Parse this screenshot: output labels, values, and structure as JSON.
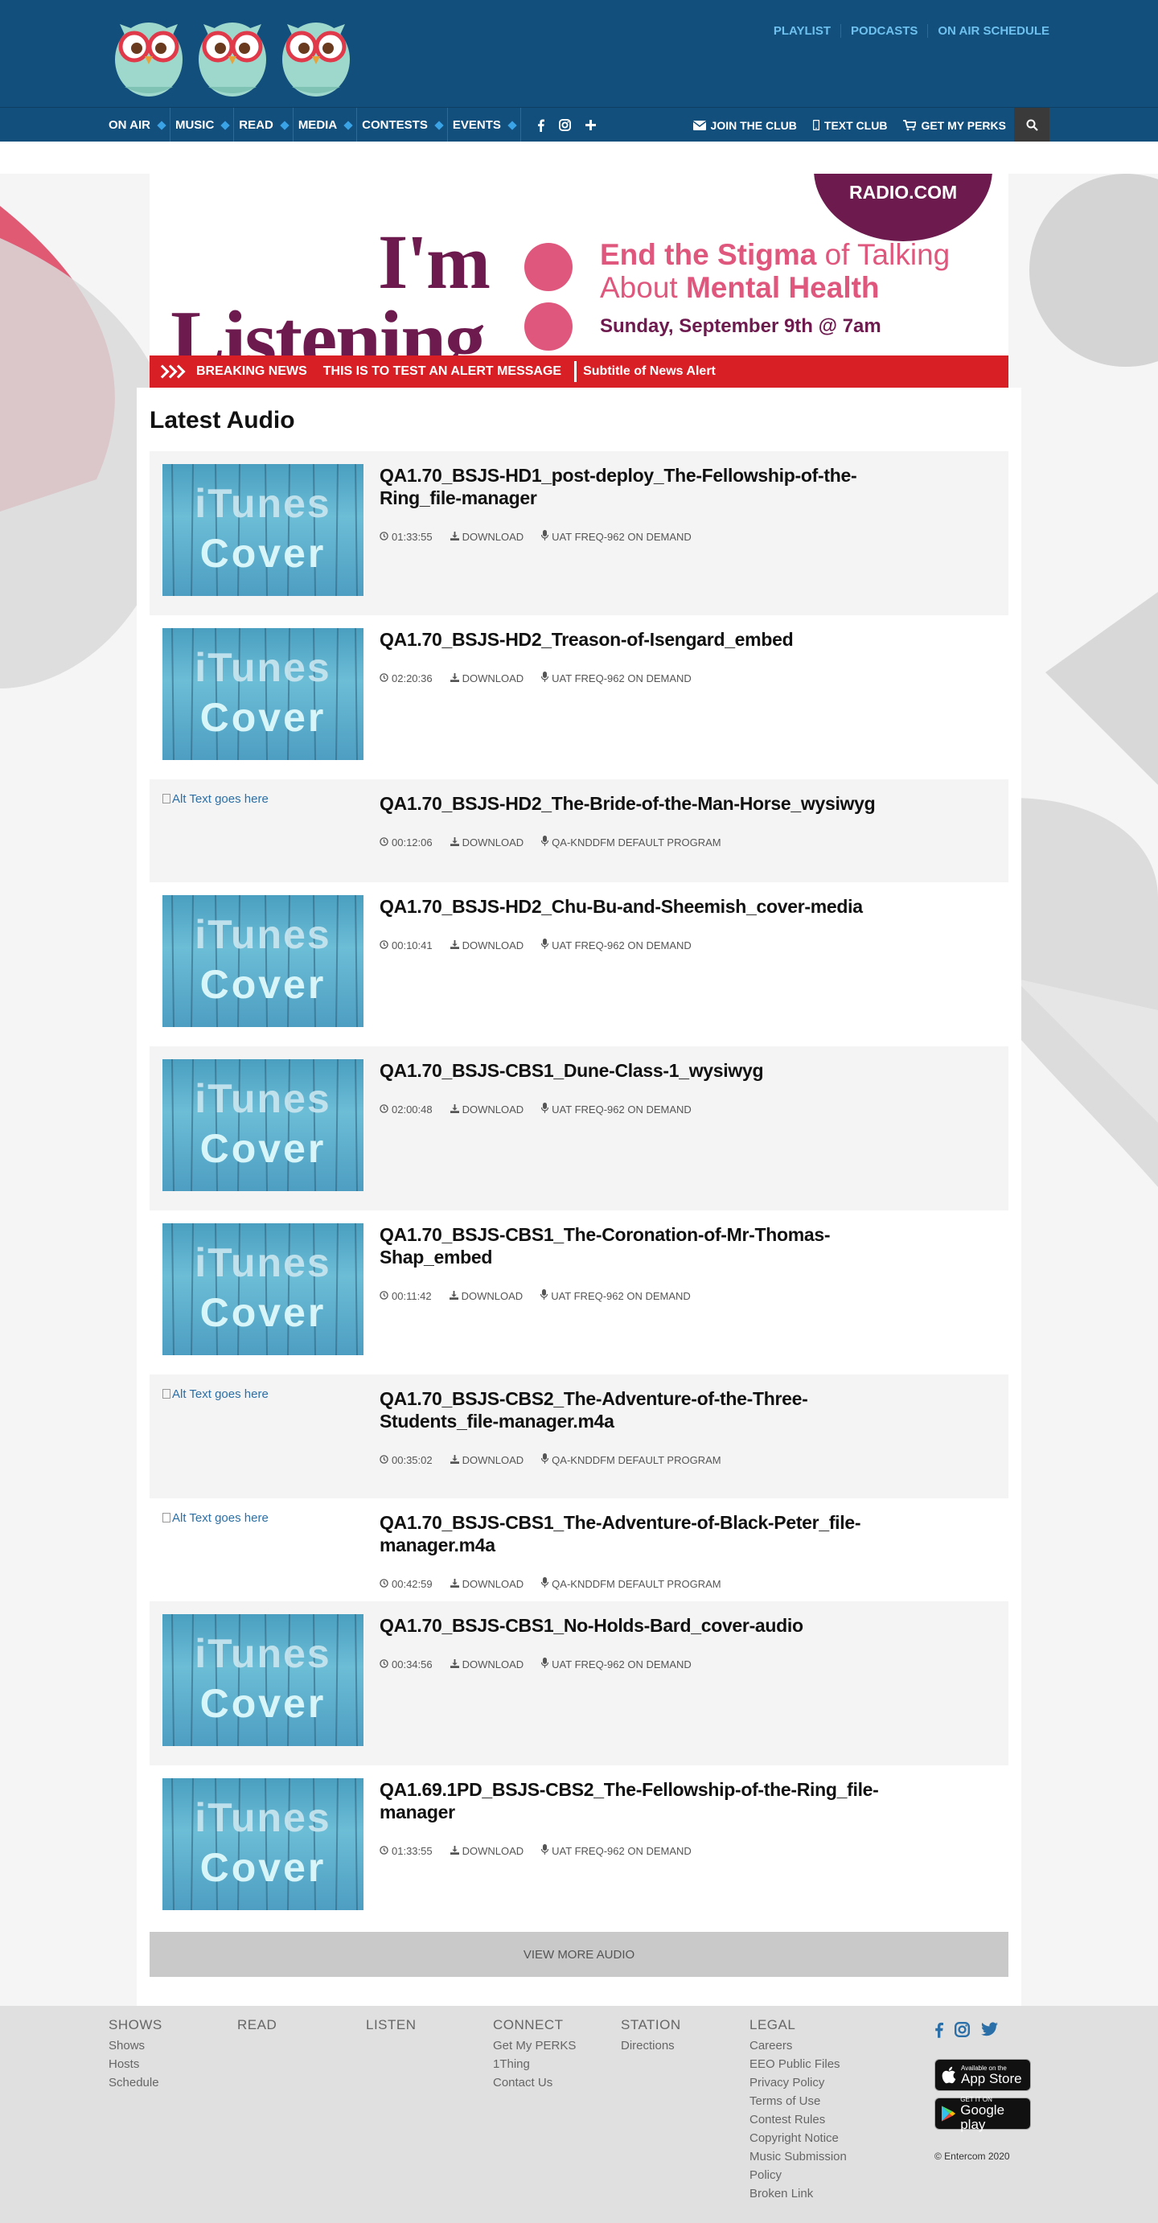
{
  "header": {
    "top_links": [
      "PLAYLIST",
      "PODCASTS",
      "ON AIR SCHEDULE"
    ],
    "nav": [
      "ON AIR",
      "MUSIC",
      "READ",
      "MEDIA",
      "CONTESTS",
      "EVENTS"
    ],
    "right_links": {
      "join": "JOIN THE CLUB",
      "text": "TEXT CLUB",
      "perks": "GET MY PERKS"
    }
  },
  "banner": {
    "radio": "RADIO.COM",
    "im": "I'm",
    "listening": "Listening",
    "line1_a": "End the Stigma",
    "line1_b": " of Talking",
    "line2_a": "About ",
    "line2_b": "Mental Health",
    "date": "Sunday, September 9th @ 7am"
  },
  "breaking": {
    "label": "BREAKING NEWS",
    "message": "THIS IS TO TEST AN ALERT MESSAGE",
    "subtitle": "Subtitle of News Alert"
  },
  "main": {
    "section_title": "Latest Audio",
    "download_label": "DOWNLOAD",
    "thumb_text": [
      "iTunes",
      "Cover"
    ],
    "alt_text": "Alt Text goes here",
    "items": [
      {
        "title": "QA1.70_BSJS-HD1_post-deploy_The-Fellowship-of-the-Ring_file-manager",
        "duration": "01:33:55",
        "program": "UAT FREQ-962 ON DEMAND",
        "image": true
      },
      {
        "title": "QA1.70_BSJS-HD2_Treason-of-Isengard_embed",
        "duration": "02:20:36",
        "program": "UAT FREQ-962 ON DEMAND",
        "image": true
      },
      {
        "title": "QA1.70_BSJS-HD2_The-Bride-of-the-Man-Horse_wysiwyg",
        "duration": "00:12:06",
        "program": "QA-KNDDFM DEFAULT PROGRAM",
        "image": false
      },
      {
        "title": "QA1.70_BSJS-HD2_Chu-Bu-and-Sheemish_cover-media",
        "duration": "00:10:41",
        "program": "UAT FREQ-962 ON DEMAND",
        "image": true
      },
      {
        "title": "QA1.70_BSJS-CBS1_Dune-Class-1_wysiwyg",
        "duration": "02:00:48",
        "program": "UAT FREQ-962 ON DEMAND",
        "image": true
      },
      {
        "title": "QA1.70_BSJS-CBS1_The-Coronation-of-Mr-Thomas-Shap_embed",
        "duration": "00:11:42",
        "program": "UAT FREQ-962 ON DEMAND",
        "image": true
      },
      {
        "title": "QA1.70_BSJS-CBS2_The-Adventure-of-the-Three-Students_file-manager.m4a",
        "duration": "00:35:02",
        "program": "QA-KNDDFM DEFAULT PROGRAM",
        "image": false
      },
      {
        "title": "QA1.70_BSJS-CBS1_The-Adventure-of-Black-Peter_file-manager.m4a",
        "duration": "00:42:59",
        "program": "QA-KNDDFM DEFAULT PROGRAM",
        "image": false
      },
      {
        "title": "QA1.70_BSJS-CBS1_No-Holds-Bard_cover-audio",
        "duration": "00:34:56",
        "program": "UAT FREQ-962 ON DEMAND",
        "image": true
      },
      {
        "title": "QA1.69.1PD_BSJS-CBS2_The-Fellowship-of-the-Ring_file-manager",
        "duration": "01:33:55",
        "program": "UAT FREQ-962 ON DEMAND",
        "image": true
      }
    ],
    "view_more": "VIEW MORE AUDIO"
  },
  "footer": {
    "columns": [
      {
        "heading": "SHOWS",
        "links": [
          "Shows",
          "Hosts",
          "Schedule"
        ]
      },
      {
        "heading": "READ",
        "links": []
      },
      {
        "heading": "LISTEN",
        "links": []
      },
      {
        "heading": "CONNECT",
        "links": [
          "Get My PERKS",
          "1Thing",
          "Contact Us"
        ]
      },
      {
        "heading": "STATION",
        "links": [
          "Directions"
        ]
      },
      {
        "heading": "LEGAL",
        "links": [
          "Careers",
          "EEO Public Files",
          "Privacy Policy",
          "Terms of Use",
          "Contest Rules",
          "Copyright Notice",
          "Music Submission Policy",
          "Broken Link"
        ]
      }
    ],
    "app_store": {
      "small": "Available on the",
      "big": "App Store"
    },
    "google_play": {
      "small": "GET IT ON",
      "big": "Google play"
    },
    "copyright": "© Entercom 2020"
  },
  "colors": {
    "header_bg": "#134f7c",
    "link_blue": "#6ec1ee",
    "alert_red": "#d91f26",
    "brand_plum": "#6d1a4e",
    "brand_pink": "#e0577e"
  },
  "icons": [
    "search-icon",
    "envelope-icon",
    "mobile-icon",
    "cart-icon",
    "facebook-icon",
    "instagram-icon",
    "plus-icon",
    "twitter-icon",
    "clock-icon",
    "download-icon",
    "microphone-icon"
  ]
}
